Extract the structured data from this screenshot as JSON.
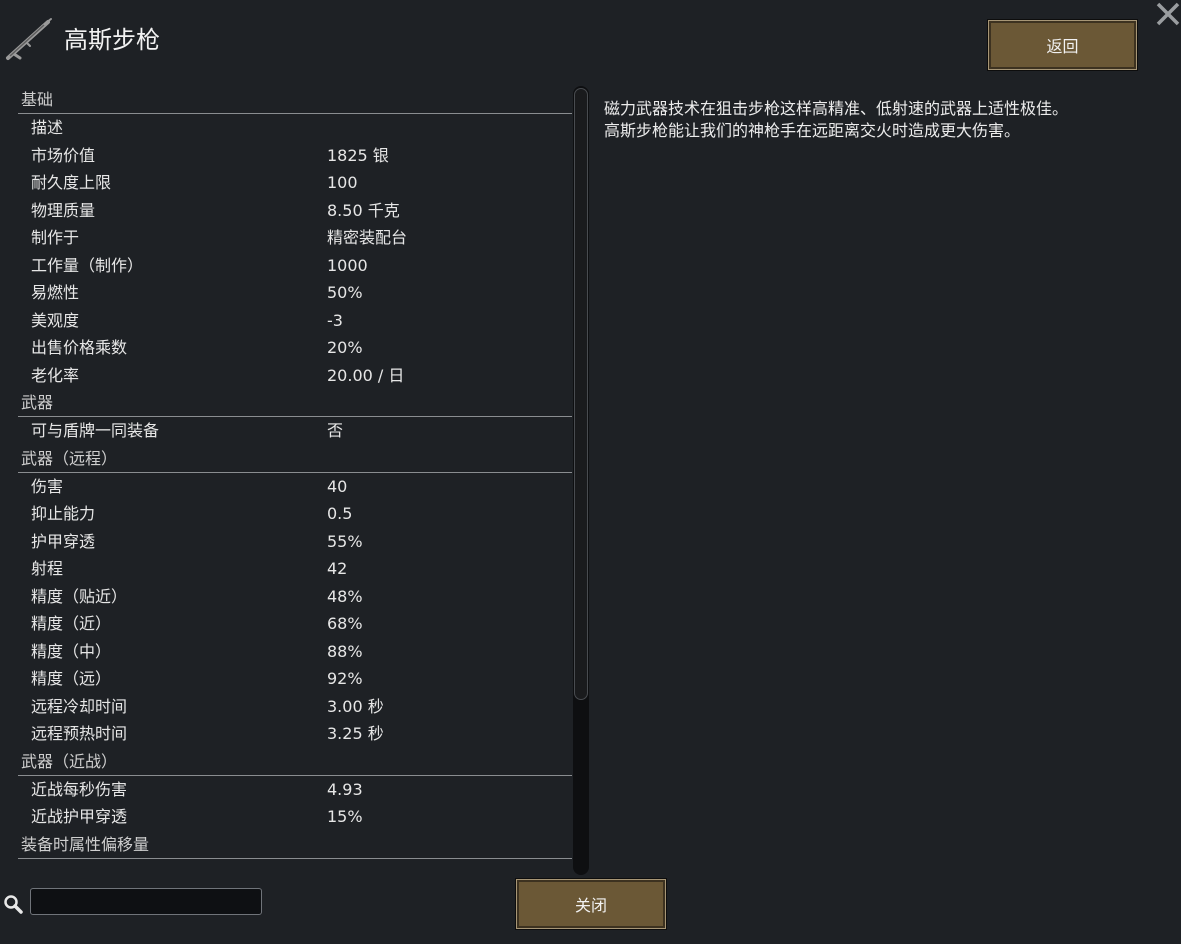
{
  "window": {
    "title": "高斯步枪",
    "back_label": "返回",
    "close_label": "关闭",
    "title_icon": "rifle-icon",
    "close_icon": "close-x-icon"
  },
  "description": "磁力武器技术在狙击步枪这样高精准、低射速的武器上适性极佳。\n高斯步枪能让我们的神枪手在远距离交火时造成更大伤害。",
  "search": {
    "value": "",
    "placeholder": ""
  },
  "sections": [
    {
      "category": "基础",
      "rows": [
        {
          "label": "描述",
          "value": ""
        },
        {
          "label": "市场价值",
          "value": "1825 银"
        },
        {
          "label": "耐久度上限",
          "value": "100"
        },
        {
          "label": "物理质量",
          "value": "8.50 千克"
        },
        {
          "label": "制作于",
          "value": "精密装配台"
        },
        {
          "label": "工作量（制作）",
          "value": "1000"
        },
        {
          "label": "易燃性",
          "value": "50%"
        },
        {
          "label": "美观度",
          "value": "-3"
        },
        {
          "label": "出售价格乘数",
          "value": "20%"
        },
        {
          "label": "老化率",
          "value": "20.00 / 日"
        }
      ]
    },
    {
      "category": "武器",
      "rows": [
        {
          "label": "可与盾牌一同装备",
          "value": "否"
        }
      ]
    },
    {
      "category": "武器（远程）",
      "rows": [
        {
          "label": "伤害",
          "value": "40"
        },
        {
          "label": "抑止能力",
          "value": "0.5"
        },
        {
          "label": "护甲穿透",
          "value": "55%"
        },
        {
          "label": "射程",
          "value": "42"
        },
        {
          "label": "精度（贴近）",
          "value": "48%"
        },
        {
          "label": "精度（近）",
          "value": "68%"
        },
        {
          "label": "精度（中）",
          "value": "88%"
        },
        {
          "label": "精度（远）",
          "value": "92%"
        },
        {
          "label": "远程冷却时间",
          "value": "3.00 秒"
        },
        {
          "label": "远程预热时间",
          "value": "3.25 秒"
        }
      ]
    },
    {
      "category": "武器（近战）",
      "rows": [
        {
          "label": "近战每秒伤害",
          "value": "4.93"
        },
        {
          "label": "近战护甲穿透",
          "value": "15%"
        }
      ]
    },
    {
      "category": "装备时属性偏移量",
      "rows": []
    }
  ]
}
